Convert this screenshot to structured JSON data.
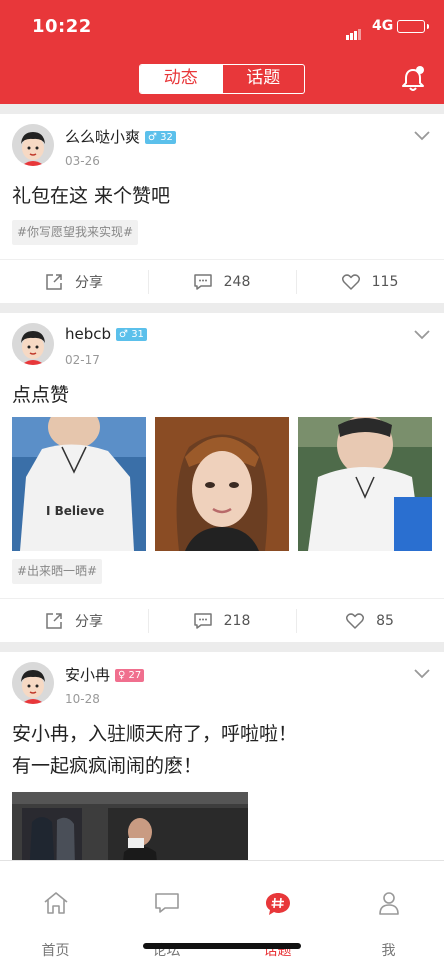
{
  "status_bar": {
    "time": "10:22",
    "network": "4G"
  },
  "header": {
    "tabs": [
      "动态",
      "话题"
    ],
    "active_tab": 0,
    "bell_icon": "bell-icon"
  },
  "posts": [
    {
      "user": "么么哒小爽",
      "gender": "male",
      "gender_symbol": "♂",
      "age": "32",
      "date": "03-26",
      "text": "礼包在这 来个赞吧",
      "tag": "#你写愿望我来实现#",
      "share_label": "分享",
      "comments": "248",
      "likes": "115"
    },
    {
      "user": "hebcb",
      "gender": "male",
      "gender_symbol": "♂",
      "age": "31",
      "date": "02-17",
      "text": "点点赞",
      "tag": "#出来晒一晒#",
      "photo_text": "I Believe",
      "share_label": "分享",
      "comments": "218",
      "likes": "85"
    },
    {
      "user": "安小冉",
      "gender": "female",
      "gender_symbol": "♀",
      "age": "27",
      "date": "10-28",
      "text_line1": "安小冉，入驻顺天府了，呼啦啦！",
      "text_line2": "有一起疯疯闹闹的麽！"
    }
  ],
  "tabbar": {
    "items": [
      {
        "label": "首页",
        "icon": "home-icon"
      },
      {
        "label": "论坛",
        "icon": "chat-icon"
      },
      {
        "label": "话题",
        "icon": "hashtag-icon"
      },
      {
        "label": "我",
        "icon": "person-icon"
      }
    ],
    "active": 2
  },
  "colors": {
    "accent": "#e8373a",
    "male_badge": "#5bc0eb",
    "female_badge": "#f06f8e"
  }
}
